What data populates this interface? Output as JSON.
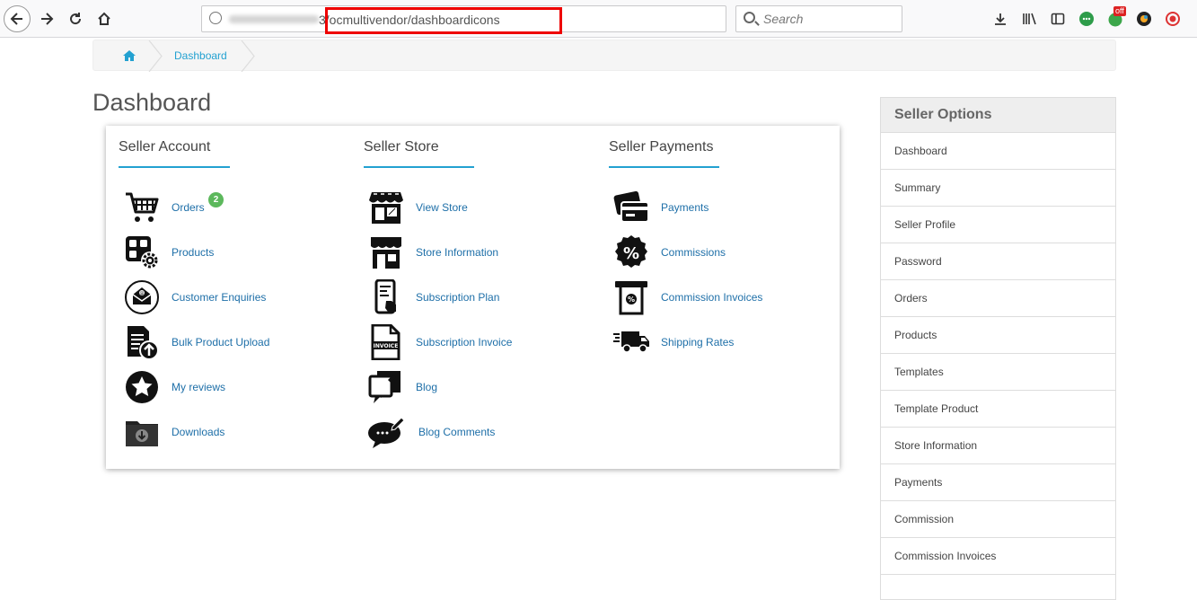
{
  "browser": {
    "url_blurred_suffix": "3",
    "url_path": "/ocmultivendor/dashboardicons",
    "search_placeholder": "Search",
    "badge_off": "off"
  },
  "breadcrumb": {
    "home_icon": "home-icon",
    "dashboard_label": "Dashboard"
  },
  "page_title": "Dashboard",
  "columns": {
    "account": {
      "title": "Seller Account",
      "items": [
        {
          "label": "Orders",
          "icon": "cart-icon",
          "badge": "2"
        },
        {
          "label": "Products",
          "icon": "products-gear-icon"
        },
        {
          "label": "Customer Enquiries",
          "icon": "envelope-icon"
        },
        {
          "label": "Bulk Product Upload",
          "icon": "upload-doc-icon"
        },
        {
          "label": "My reviews",
          "icon": "star-badge-icon"
        },
        {
          "label": "Downloads",
          "icon": "download-folder-icon"
        }
      ]
    },
    "store": {
      "title": "Seller Store",
      "items": [
        {
          "label": "View Store",
          "icon": "storefront-icon"
        },
        {
          "label": "Store Information",
          "icon": "store-info-icon"
        },
        {
          "label": "Subscription Plan",
          "icon": "phone-plan-icon"
        },
        {
          "label": "Subscription Invoice",
          "icon": "invoice-doc-icon"
        },
        {
          "label": "Blog",
          "icon": "blog-icon"
        },
        {
          "label": "Blog Comments",
          "icon": "comment-bubble-icon"
        }
      ]
    },
    "payments": {
      "title": "Seller Payments",
      "items": [
        {
          "label": "Payments",
          "icon": "card-icon"
        },
        {
          "label": "Commissions",
          "icon": "percent-badge-icon"
        },
        {
          "label": "Commission Invoices",
          "icon": "receipt-percent-icon"
        },
        {
          "label": "Shipping Rates",
          "icon": "truck-icon"
        }
      ]
    }
  },
  "sidebar": {
    "title": "Seller Options",
    "items": [
      "Dashboard",
      "Summary",
      "Seller Profile",
      "Password",
      "Orders",
      "Products",
      "Templates",
      "Template Product",
      "Store Information",
      "Payments",
      "Commission",
      "Commission Invoices"
    ]
  }
}
